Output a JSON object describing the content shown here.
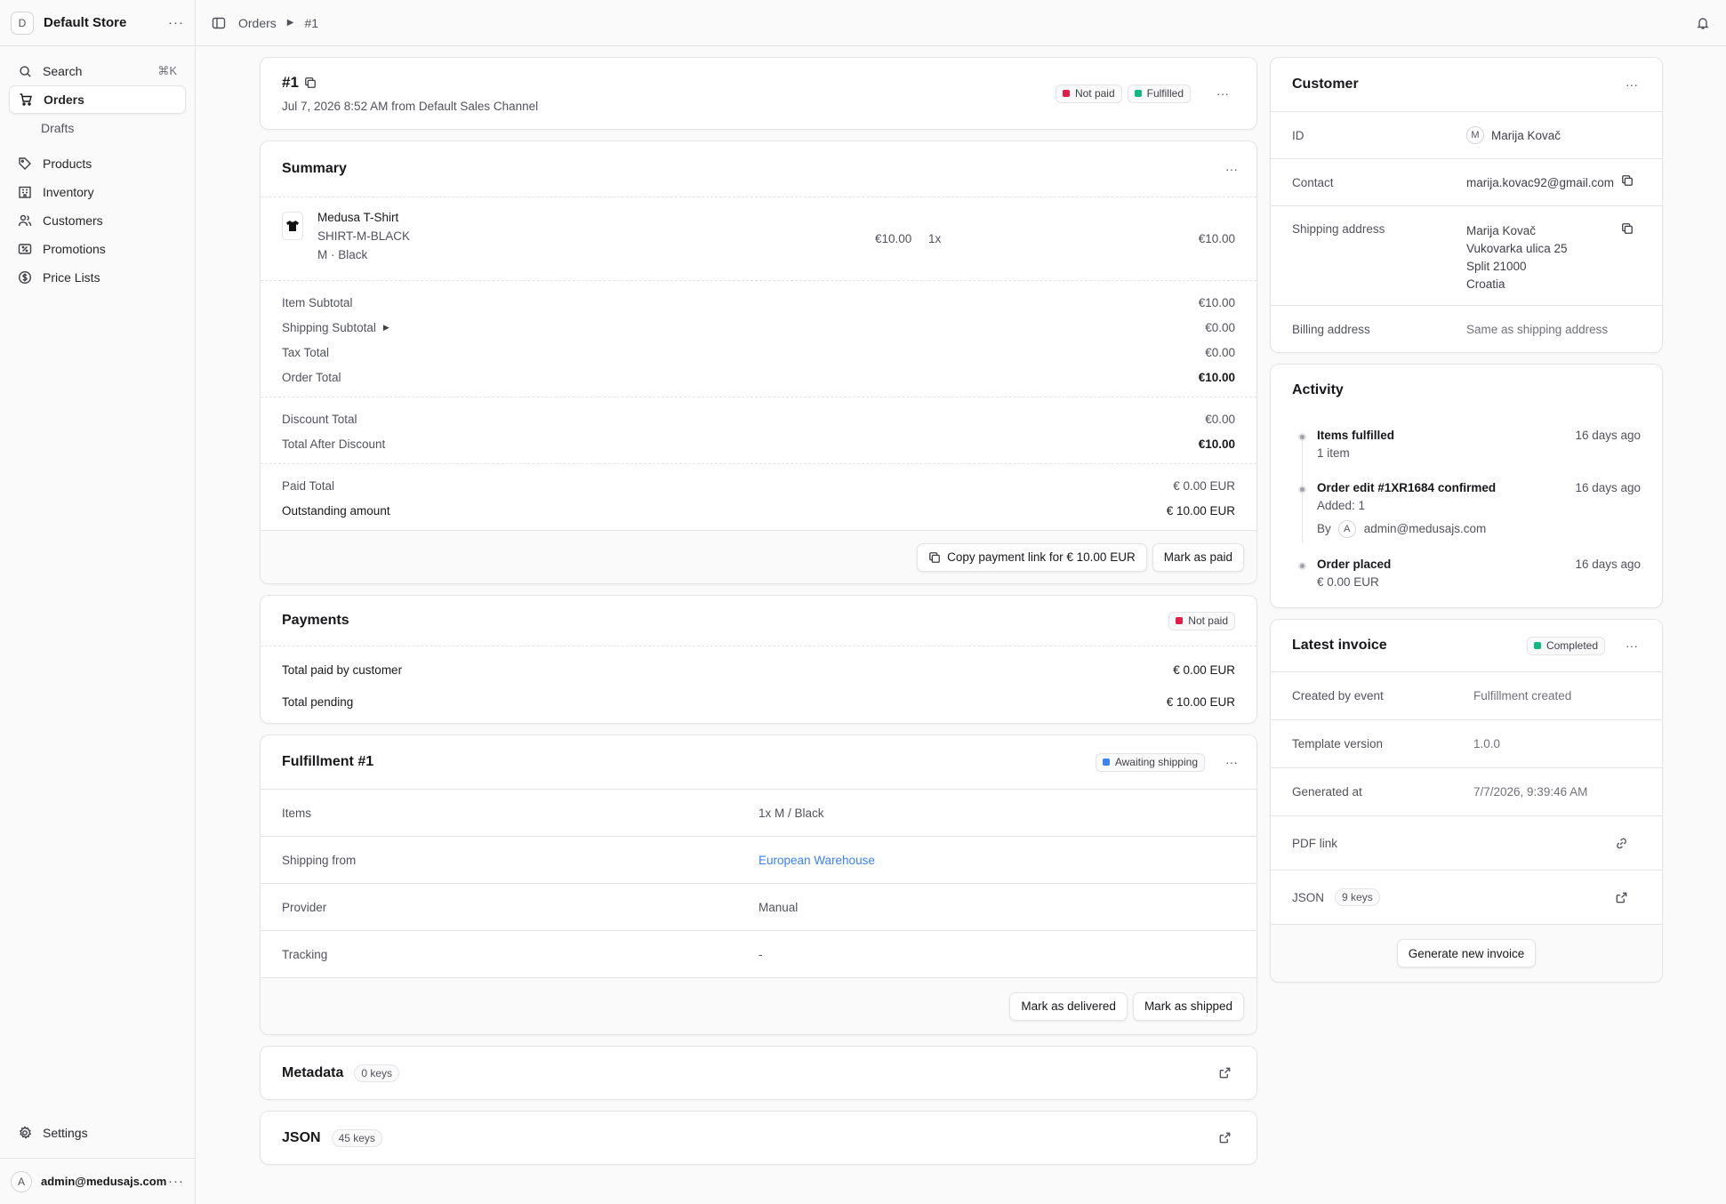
{
  "sidebar": {
    "store_initial": "D",
    "store_name": "Default Store",
    "search_label": "Search",
    "search_shortcut": "⌘K",
    "items": [
      {
        "label": "Orders"
      },
      {
        "label": "Drafts"
      },
      {
        "label": "Products"
      },
      {
        "label": "Inventory"
      },
      {
        "label": "Customers"
      },
      {
        "label": "Promotions"
      },
      {
        "label": "Price Lists"
      }
    ],
    "settings_label": "Settings",
    "user_initial": "A",
    "user_email": "admin@medusajs.com"
  },
  "breadcrumb": {
    "orders": "Orders",
    "current": "#1"
  },
  "order": {
    "title": "#1",
    "subtitle": "Jul 7, 2026 8:52 AM from Default Sales Channel",
    "payment_status": "Not paid",
    "fulfillment_status": "Fulfilled"
  },
  "summary": {
    "title": "Summary",
    "item": {
      "name": "Medusa T-Shirt",
      "sku": "SHIRT-M-BLACK",
      "variant": "M · Black",
      "unit_price": "€10.00",
      "quantity": "1x",
      "total": "€10.00"
    },
    "totals": [
      {
        "label": "Item Subtotal",
        "value": "€10.00"
      },
      {
        "label": "Shipping Subtotal",
        "value": "€0.00"
      },
      {
        "label": "Tax Total",
        "value": "€0.00"
      },
      {
        "label": "Order Total",
        "value": "€10.00"
      }
    ],
    "discount": [
      {
        "label": "Discount Total",
        "value": "€0.00"
      },
      {
        "label": "Total After Discount",
        "value": "€10.00"
      }
    ],
    "paid": [
      {
        "label": "Paid Total",
        "value": "€ 0.00 EUR"
      },
      {
        "label": "Outstanding amount",
        "value": "€ 10.00 EUR"
      }
    ],
    "copy_link_label": "Copy payment link for € 10.00 EUR",
    "mark_paid_label": "Mark as paid"
  },
  "payments": {
    "title": "Payments",
    "status": "Not paid",
    "rows": [
      {
        "label": "Total paid by customer",
        "value": "€ 0.00 EUR"
      },
      {
        "label": "Total pending",
        "value": "€ 10.00 EUR"
      }
    ]
  },
  "fulfillment": {
    "title": "Fulfillment #1",
    "status": "Awaiting shipping",
    "rows": [
      {
        "label": "Items",
        "value": "1x M / Black"
      },
      {
        "label": "Shipping from",
        "value": "European Warehouse"
      },
      {
        "label": "Provider",
        "value": "Manual"
      },
      {
        "label": "Tracking",
        "value": "-"
      }
    ],
    "mark_delivered_label": "Mark as delivered",
    "mark_shipped_label": "Mark as shipped"
  },
  "metadata": {
    "title": "Metadata",
    "keys": "0 keys"
  },
  "json": {
    "title": "JSON",
    "keys": "45 keys"
  },
  "customer": {
    "title": "Customer",
    "id_label": "ID",
    "id_initial": "M",
    "id_name": "Marija Kovač",
    "contact_label": "Contact",
    "contact_value": "marija.kovac92@gmail.com",
    "shipping_label": "Shipping address",
    "shipping_lines": [
      "Marija Kovač",
      "Vukovarka ulica 25",
      "Split 21000",
      "Croatia"
    ],
    "billing_label": "Billing address",
    "billing_value": "Same as shipping address"
  },
  "activity": {
    "title": "Activity",
    "events": [
      {
        "title": "Items fulfilled",
        "detail": "1 item",
        "time": "16 days ago"
      },
      {
        "title": "Order edit #1XR1684 confirmed",
        "detail": "Added: 1",
        "by_label": "By",
        "by_initial": "A",
        "by_email": "admin@medusajs.com",
        "time": "16 days ago"
      },
      {
        "title": "Order placed",
        "detail": "€ 0.00 EUR",
        "time": "16 days ago"
      }
    ]
  },
  "invoice": {
    "title": "Latest invoice",
    "status": "Completed",
    "rows": [
      {
        "label": "Created by event",
        "value": "Fulfillment created"
      },
      {
        "label": "Template version",
        "value": "1.0.0"
      },
      {
        "label": "Generated at",
        "value": "7/7/2026, 9:39:46 AM"
      }
    ],
    "pdf_label": "PDF link",
    "json_label": "JSON",
    "json_keys": "9 keys",
    "generate_label": "Generate new invoice"
  },
  "colors": {
    "red": "#e11d48",
    "green": "#10b981",
    "blue": "#3b82f6"
  }
}
